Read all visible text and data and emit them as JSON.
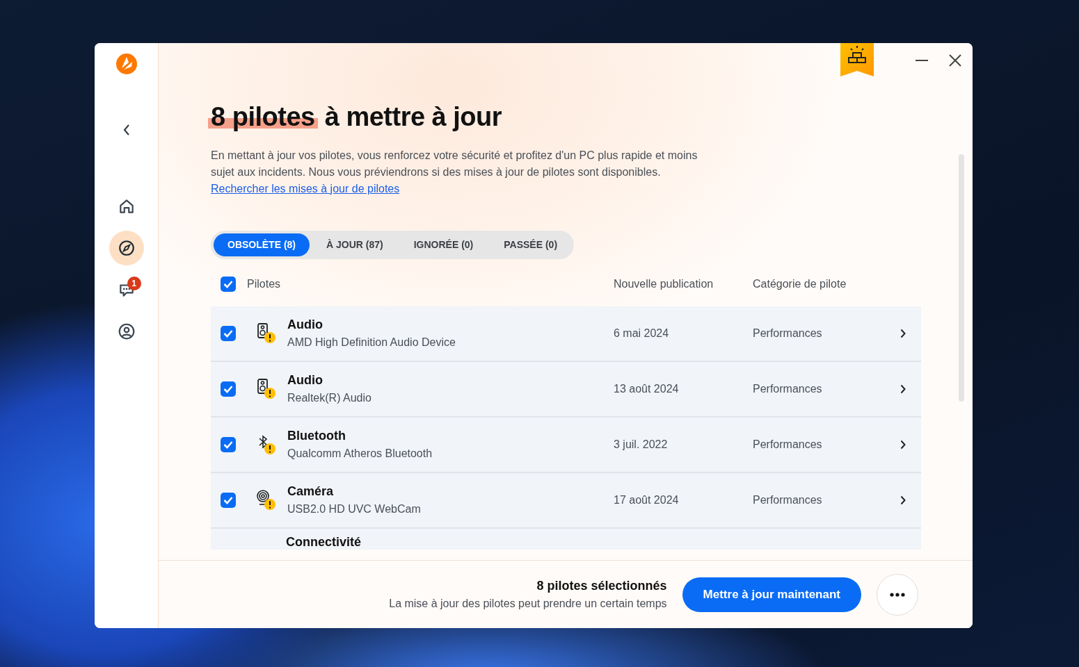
{
  "sidebar": {
    "nav": [
      {
        "kind": "home",
        "selected": false
      },
      {
        "kind": "compass",
        "selected": true
      },
      {
        "kind": "chat",
        "selected": false,
        "badge": "1"
      },
      {
        "kind": "user",
        "selected": false
      }
    ]
  },
  "heading": {
    "highlight": "8 pilotes",
    "rest": "à mettre à jour"
  },
  "description": {
    "text": "En mettant à jour vos pilotes, vous renforcez votre sécurité et profitez d'un PC plus rapide et moins sujet aux incidents. Nous vous préviendrons si des mises à jour de pilotes sont disponibles.",
    "link": "Rechercher les mises à jour de pilotes"
  },
  "tabs": [
    {
      "label": "OBSOLÈTE (8)",
      "selected": true
    },
    {
      "label": "À JOUR (87)",
      "selected": false
    },
    {
      "label": "IGNORÉE (0)",
      "selected": false
    },
    {
      "label": "PASSÉE (0)",
      "selected": false
    }
  ],
  "table": {
    "select_all": {
      "checked": true
    },
    "columns": [
      "Pilotes",
      "Nouvelle publication",
      "Catégorie de pilote"
    ],
    "rows": [
      {
        "kind": "speaker",
        "checked": true,
        "title": "Audio",
        "subtitle": "AMD High Definition Audio Device",
        "date": "6 mai 2024",
        "category": "Performances"
      },
      {
        "kind": "speaker",
        "checked": true,
        "title": "Audio",
        "subtitle": "Realtek(R) Audio",
        "date": "13 août 2024",
        "category": "Performances"
      },
      {
        "kind": "bluetooth",
        "checked": true,
        "title": "Bluetooth",
        "subtitle": "Qualcomm Atheros Bluetooth",
        "date": "3 juil. 2022",
        "category": "Performances"
      },
      {
        "kind": "webcam",
        "checked": true,
        "title": "Caméra",
        "subtitle": "USB2.0 HD UVC WebCam",
        "date": "17 août 2024",
        "category": "Performances"
      },
      {
        "kind": "partial",
        "title": "Connectivité"
      }
    ]
  },
  "footer": {
    "count": "8 pilotes sélectionnés",
    "note": "La mise à jour des pilotes peut prendre un certain temps",
    "primary": "Mettre à jour maintenant"
  }
}
